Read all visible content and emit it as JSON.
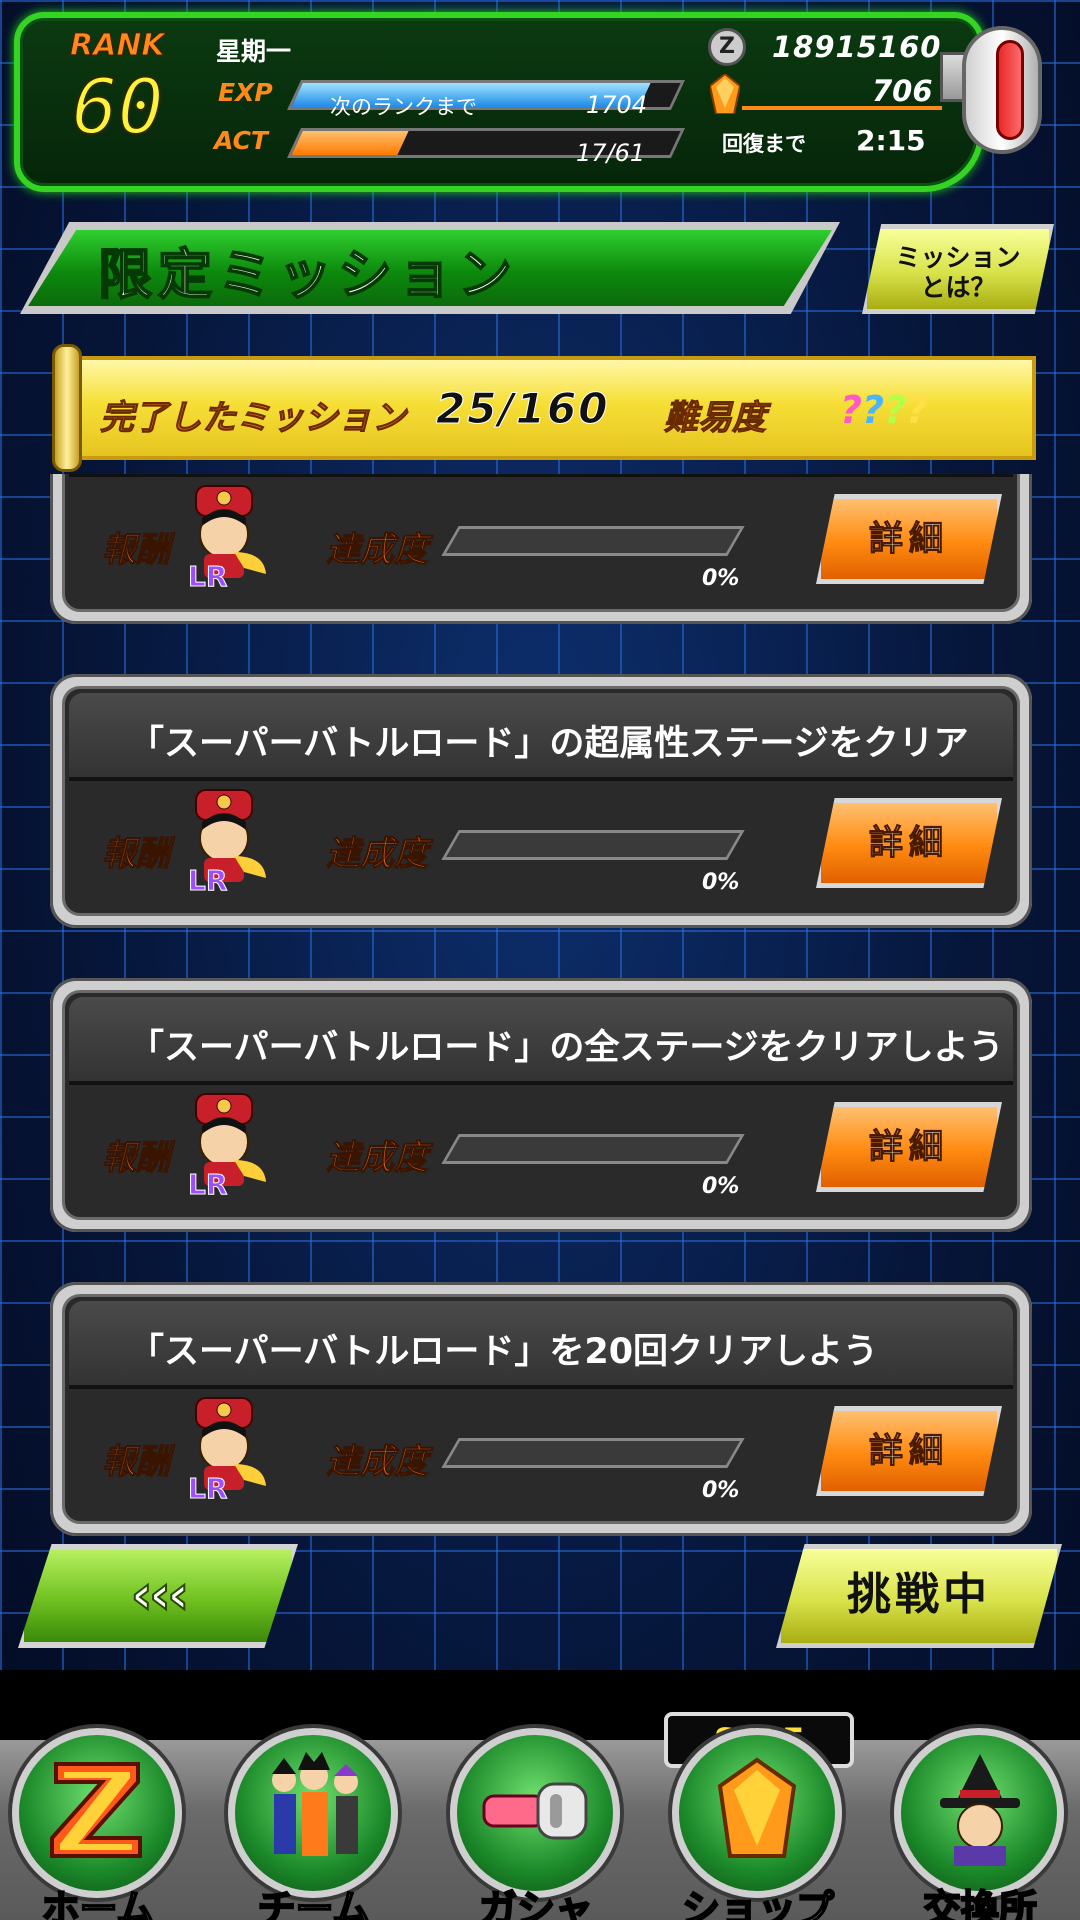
{
  "status": {
    "rank_label": "RANK",
    "rank_value": "60",
    "day": "星期一",
    "exp_label": "EXP",
    "exp_caption": "次のランクまで",
    "exp_remaining": "1704",
    "exp_progress": 0.92,
    "act_label": "ACT",
    "act_value": "17/61",
    "act_progress": 0.28,
    "zeni_icon_text": "Z",
    "zeni": "18915160",
    "stones": "706",
    "recover_label": "回復まで",
    "recover_time": "2:15"
  },
  "header": {
    "title": "限定ミッション",
    "help_button": "ミッション\nとは？"
  },
  "summary": {
    "completed_label": "完了したミッション",
    "completed_count": "25/160",
    "difficulty_label": "難易度",
    "difficulty_value": "????"
  },
  "missions": [
    {
      "title": "",
      "reward_label": "報酬",
      "progress_label": "達成度",
      "progress_pct": "0%",
      "progress": 0,
      "detail_label": "詳細"
    },
    {
      "title": "「スーパーバトルロード」の超属性ステージをクリア",
      "reward_label": "報酬",
      "progress_label": "達成度",
      "progress_pct": "0%",
      "progress": 0,
      "detail_label": "詳細"
    },
    {
      "title": "「スーパーバトルロード」の全ステージをクリアしよう",
      "reward_label": "報酬",
      "progress_label": "達成度",
      "progress_pct": "0%",
      "progress": 0,
      "detail_label": "詳細"
    },
    {
      "title": "「スーパーバトルロード」を20回クリアしよう",
      "reward_label": "報酬",
      "progress_label": "達成度",
      "progress_pct": "0%",
      "progress": 0,
      "detail_label": "詳細"
    }
  ],
  "actions": {
    "back_label": "‹‹‹",
    "challenge_label": "挑戦中"
  },
  "nav": {
    "sale_badge": "SALE",
    "items": [
      {
        "label": "ホーム",
        "icon": "dragonball-z-logo-icon"
      },
      {
        "label": "チーム",
        "icon": "team-characters-icon"
      },
      {
        "label": "ガシャ",
        "icon": "capsule-icon"
      },
      {
        "label": "ショップ",
        "icon": "dragon-stone-icon"
      },
      {
        "label": "交換所",
        "icon": "baba-witch-icon"
      }
    ]
  }
}
